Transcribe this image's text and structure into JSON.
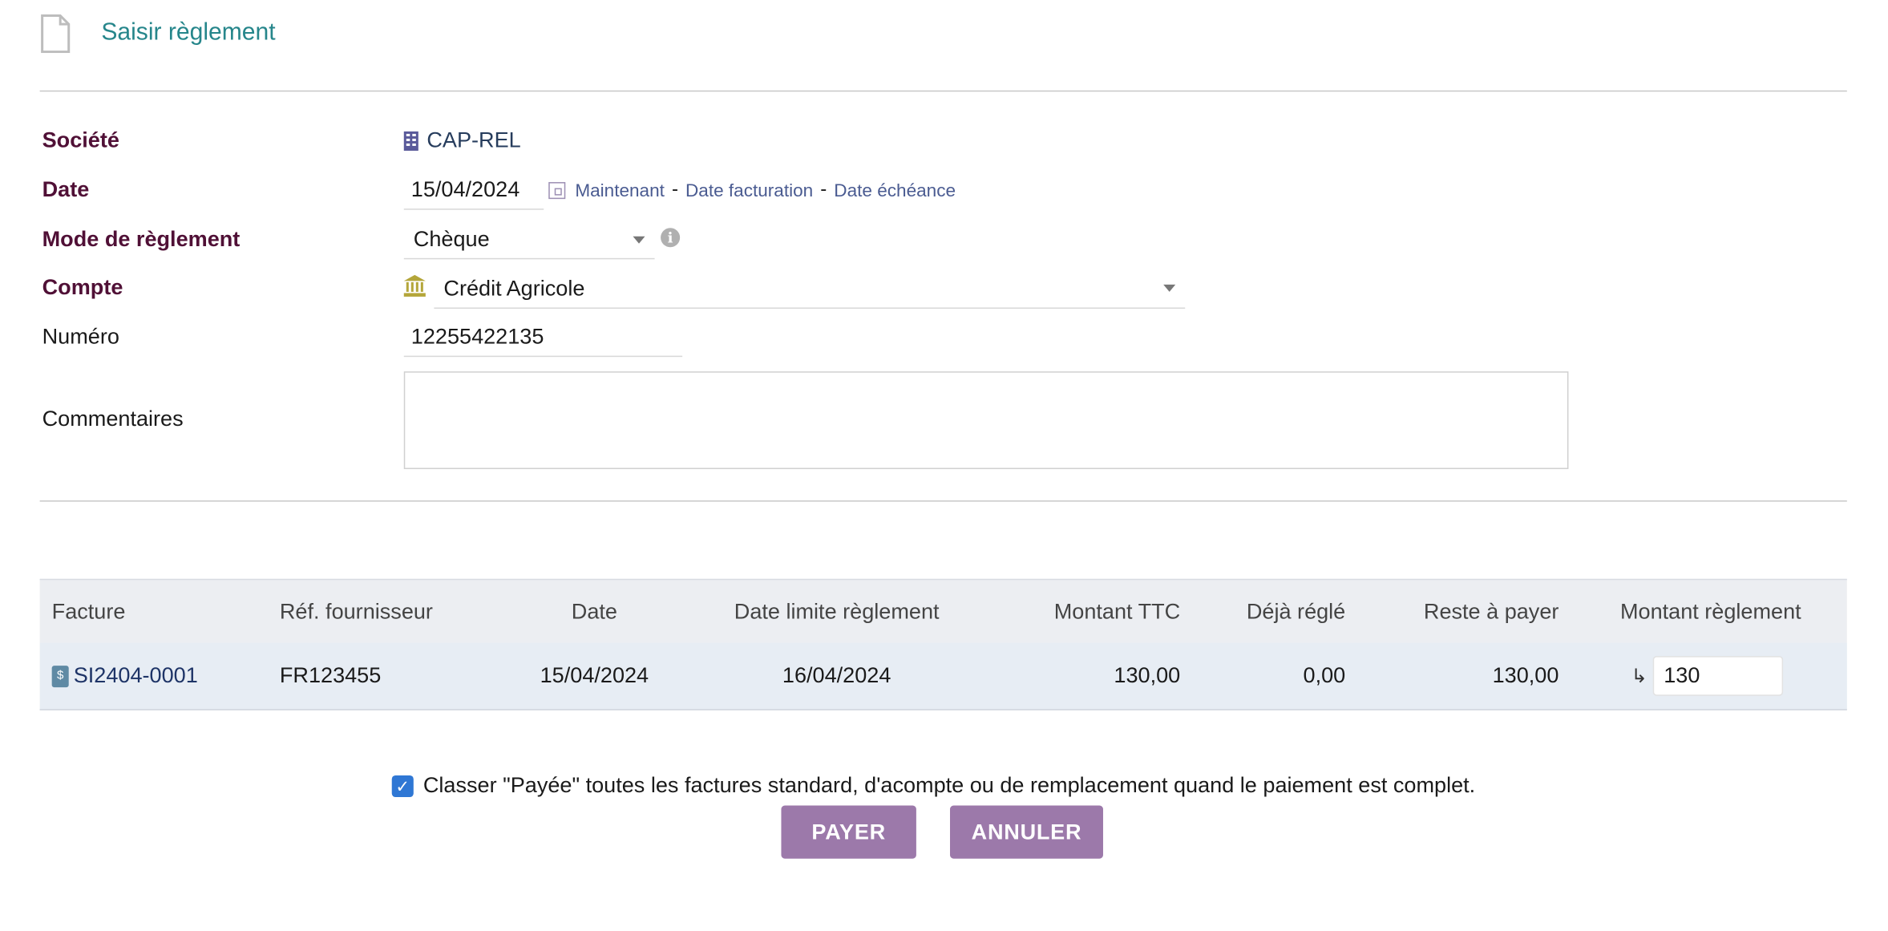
{
  "page": {
    "title": "Saisir règlement"
  },
  "form": {
    "societe": {
      "label": "Société",
      "value": "CAP-REL"
    },
    "date": {
      "label": "Date",
      "value": "15/04/2024",
      "links": [
        "Maintenant",
        "Date facturation",
        "Date échéance"
      ],
      "separator": "-"
    },
    "mode": {
      "label": "Mode de règlement",
      "value": "Chèque"
    },
    "compte": {
      "label": "Compte",
      "value": "Crédit Agricole"
    },
    "numero": {
      "label": "Numéro",
      "value": "12255422135"
    },
    "commentaires": {
      "label": "Commentaires",
      "value": ""
    }
  },
  "table": {
    "headers": [
      "Facture",
      "Réf. fournisseur",
      "Date",
      "Date limite règlement",
      "Montant TTC",
      "Déjà réglé",
      "Reste à payer",
      "Montant règlement"
    ],
    "rows": [
      {
        "facture": "SI2404-0001",
        "ref_fournisseur": "FR123455",
        "date": "15/04/2024",
        "date_limite": "16/04/2024",
        "montant_ttc": "130,00",
        "deja_regle": "0,00",
        "reste": "130,00",
        "montant_reglement": "130"
      }
    ]
  },
  "checkbox": {
    "checked": true,
    "label": "Classer \"Payée\" toutes les factures standard, d'acompte ou de remplacement quand le paiement est complet."
  },
  "buttons": {
    "pay": "PAYER",
    "cancel": "ANNULER"
  },
  "icons": {
    "page": "document-icon",
    "societe": "building-icon",
    "date": "calendar-icon",
    "mode_info": "info-icon",
    "compte": "bank-icon",
    "invoice": "invoice-icon",
    "fill_amount": "arrow-return-icon"
  },
  "colors": {
    "title": "#26868b",
    "required_label": "#501036",
    "button": "#9c79aa",
    "link": "#4a5b91",
    "row_bg": "#e7edf4"
  }
}
